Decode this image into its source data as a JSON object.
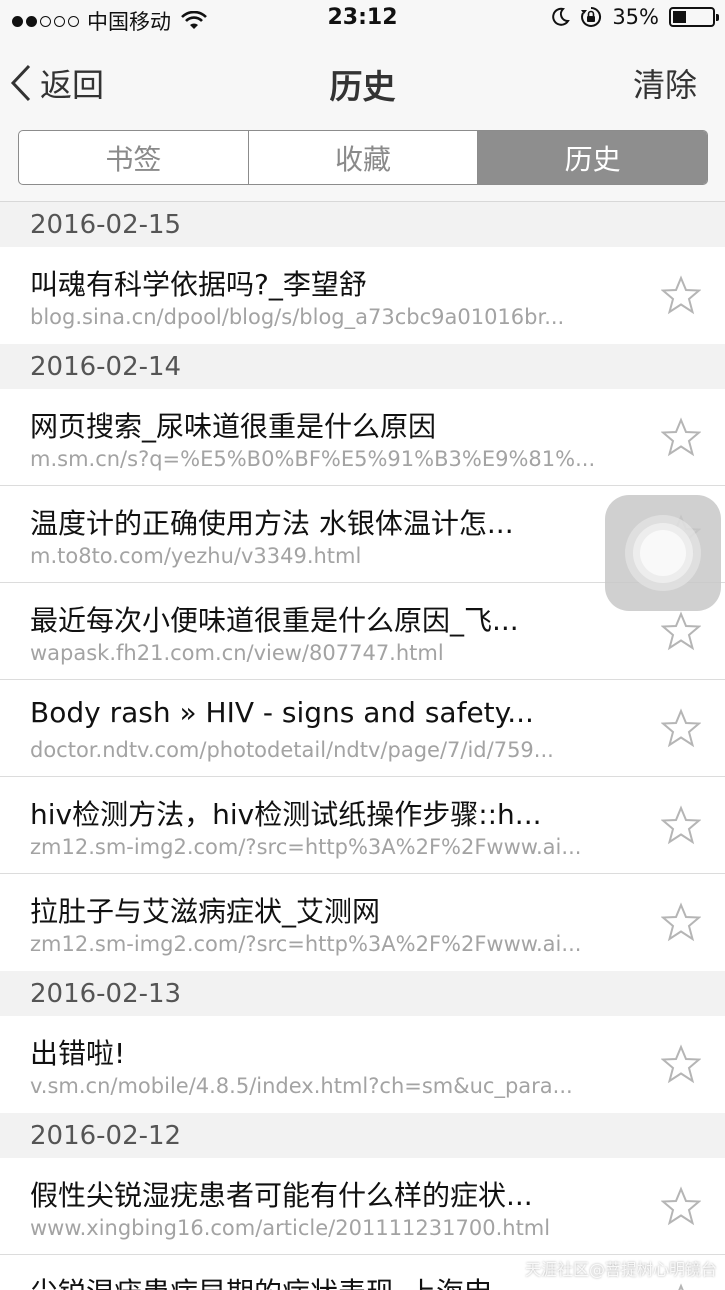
{
  "status_bar": {
    "carrier": "中国移动",
    "time": "23:12",
    "battery_percent": "35%",
    "battery_level": 0.35
  },
  "nav": {
    "back_label": "返回",
    "title": "历史",
    "clear_label": "清除"
  },
  "tabs": [
    {
      "label": "书签",
      "active": false
    },
    {
      "label": "收藏",
      "active": false
    },
    {
      "label": "历史",
      "active": true
    }
  ],
  "groups": [
    {
      "date": "2016-02-15",
      "items": [
        {
          "title": "叫魂有科学依据吗?_李望舒",
          "url": "blog.sina.cn/dpool/blog/s/blog_a73cbc9a01016br..."
        }
      ]
    },
    {
      "date": "2016-02-14",
      "items": [
        {
          "title": "网页搜索_尿味道很重是什么原因",
          "url": "m.sm.cn/s?q=%E5%B0%BF%E5%91%B3%E9%81%..."
        },
        {
          "title": "温度计的正确使用方法 水银体温计怎...",
          "url": "m.to8to.com/yezhu/v3349.html"
        },
        {
          "title": "最近每次小便味道很重是什么原因_飞...",
          "url": "wapask.fh21.com.cn/view/807747.html"
        },
        {
          "title": "Body rash » HIV - signs and safety...",
          "url": "doctor.ndtv.com/photodetail/ndtv/page/7/id/759..."
        },
        {
          "title": "hiv检测方法，hiv检测试纸操作步骤::h...",
          "url": "zm12.sm-img2.com/?src=http%3A%2F%2Fwww.ai..."
        },
        {
          "title": "拉肚子与艾滋病症状_艾测网",
          "url": "zm12.sm-img2.com/?src=http%3A%2F%2Fwww.ai..."
        }
      ]
    },
    {
      "date": "2016-02-13",
      "items": [
        {
          "title": "出错啦!",
          "url": "v.sm.cn/mobile/4.8.5/index.html?ch=sm&uc_para..."
        }
      ]
    },
    {
      "date": "2016-02-12",
      "items": [
        {
          "title": "假性尖锐湿疣患者可能有什么样的症状...",
          "url": "www.xingbing16.com/article/201111231700.html"
        },
        {
          "title": "尖锐湿疣患病早期的症状表现_上海申...",
          "url": ""
        }
      ]
    }
  ],
  "watermark": "天涯社区@菩提树心明镜台"
}
